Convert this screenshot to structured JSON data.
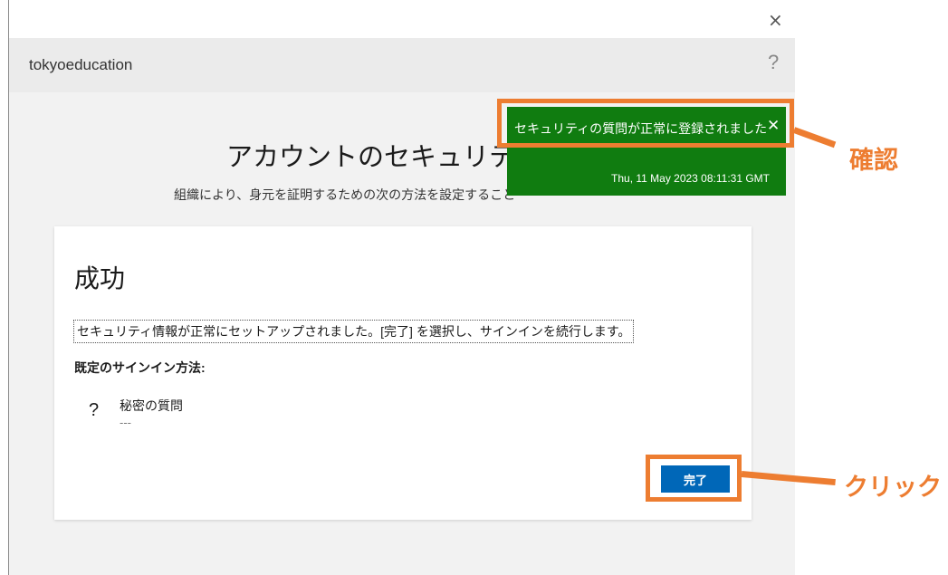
{
  "window": {
    "close_glyph": "×"
  },
  "header": {
    "tenant": "tokyoeducation",
    "help_glyph": "?"
  },
  "page": {
    "title": "アカウントのセキュリテ",
    "subtitle": "組織により、身元を証明するための次の方法を設定すること"
  },
  "card": {
    "title": "成功",
    "message": "セキュリティ情報が正常にセットアップされました。[完了] を選択し、サインインを続行します。",
    "default_method_label": "既定のサインイン方法:",
    "method": {
      "icon": "question-mark-icon",
      "icon_glyph": "?",
      "name": "秘密の質問",
      "detail": "---"
    },
    "done_button": "完了"
  },
  "toast": {
    "message": "セキュリティの質問が正常に登録されました",
    "close_glyph": "✕",
    "timestamp": "Thu, 11 May 2023 08:11:31 GMT",
    "color": "#107c10"
  },
  "annotations": {
    "confirm_label": "確認",
    "click_label": "クリック",
    "highlight_color": "#ed7d31"
  }
}
